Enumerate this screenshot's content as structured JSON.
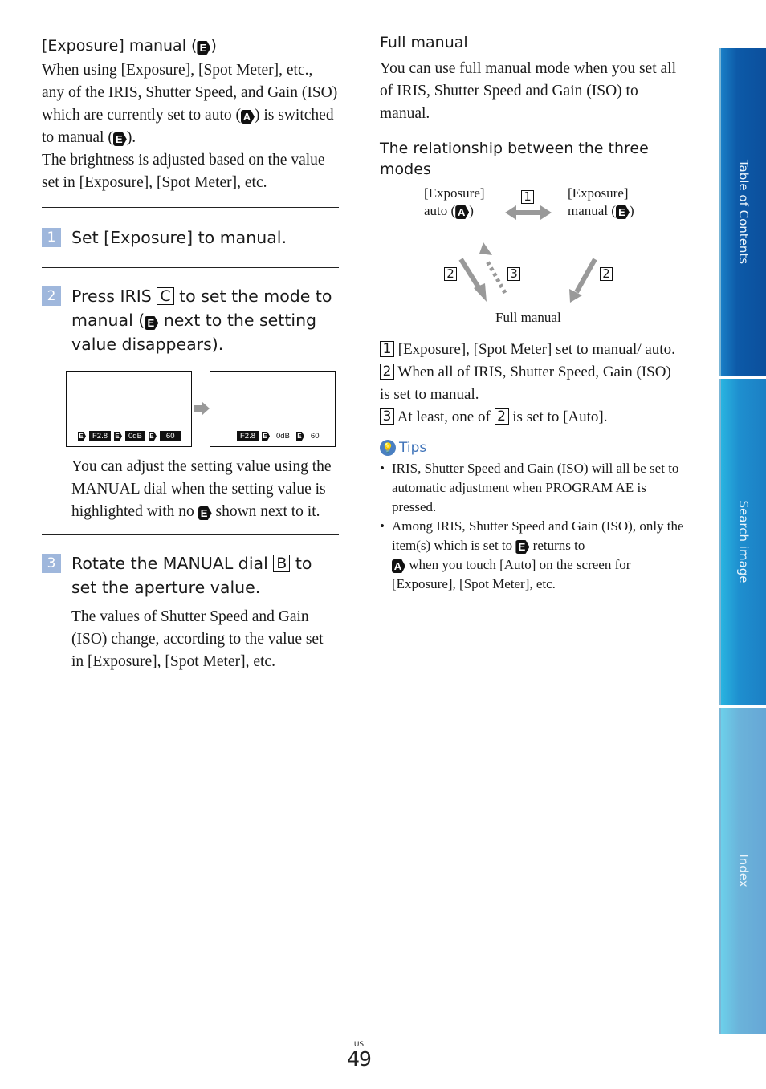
{
  "left": {
    "section_title": "[Exposure] manual (",
    "section_title_end": ")",
    "intro_1": "When using [Exposure], [Spot Meter], etc., any of the IRIS, Shutter Speed, and Gain (ISO) which are currently set to auto (",
    "intro_2": ") is switched to manual (",
    "intro_3": ").",
    "intro_4": "The brightness is adjusted based on the value set in [Exposure], [Spot Meter], etc.",
    "steps": [
      {
        "num": "1",
        "text": "Set [Exposure] to manual."
      },
      {
        "num": "2",
        "text_a": "Press IRIS ",
        "button": "C",
        "text_b": " to set the mode to manual (",
        "text_c": " next to the setting value disappears).",
        "note_a": "You can adjust the setting value using the MANUAL dial when the setting value is highlighted with no ",
        "note_b": " shown next to it."
      },
      {
        "num": "3",
        "text_a": "Rotate the MANUAL dial ",
        "button": "B",
        "text_b": " to set the aperture value.",
        "note": "The values of Shutter Speed and Gain (ISO) change, according to the value set in [Exposure], [Spot Meter], etc."
      }
    ],
    "screens": {
      "before": {
        "iris": "F2.8",
        "gain": "0dB",
        "shutter": "60"
      },
      "after": {
        "iris": "F2.8",
        "gain": "0dB",
        "shutter": "60"
      }
    }
  },
  "right": {
    "full_manual_title": "Full manual",
    "full_manual_text": "You can use full manual mode when you set all of IRIS, Shutter Speed and Gain (ISO) to manual.",
    "relationship_title": "The relationship between the three modes",
    "diagram": {
      "auto_label_1": "[Exposure]",
      "auto_label_2": "auto (",
      "manual_label_1": "[Exposure]",
      "manual_label_2": "manual (",
      "close_paren": ")",
      "full_manual_label": "Full manual",
      "marker_1": "1",
      "marker_2": "2",
      "marker_3": "3"
    },
    "legend": [
      {
        "num": "1",
        "text": "[Exposure], [Spot Meter] set to manual/ auto."
      },
      {
        "num": "2",
        "text": "When all of IRIS, Shutter Speed, Gain (ISO) is set to manual."
      },
      {
        "num": "3",
        "text_a": "At least, one of ",
        "ref": "2",
        "text_b": " is set to [Auto]."
      }
    ],
    "tips": {
      "title": "Tips",
      "items": [
        {
          "text": "IRIS, Shutter Speed and Gain (ISO) will all be set to automatic adjustment when PROGRAM AE is pressed."
        },
        {
          "text_a": "Among IRIS, Shutter Speed and Gain (ISO), only the item(s) which is set to ",
          "text_b": " returns to ",
          "text_c": " when you touch [Auto] on the screen for [Exposure], [Spot Meter], etc."
        }
      ]
    }
  },
  "icons": {
    "manual": "E",
    "auto": "A"
  },
  "side_tabs": [
    {
      "label": "Table of Contents",
      "color": "#0d5aa8"
    },
    {
      "label": "Search image",
      "color": "#1e8fcf"
    },
    {
      "label": "Index",
      "color": "#6bb3da"
    }
  ],
  "footer": {
    "region": "US",
    "page": "49"
  }
}
